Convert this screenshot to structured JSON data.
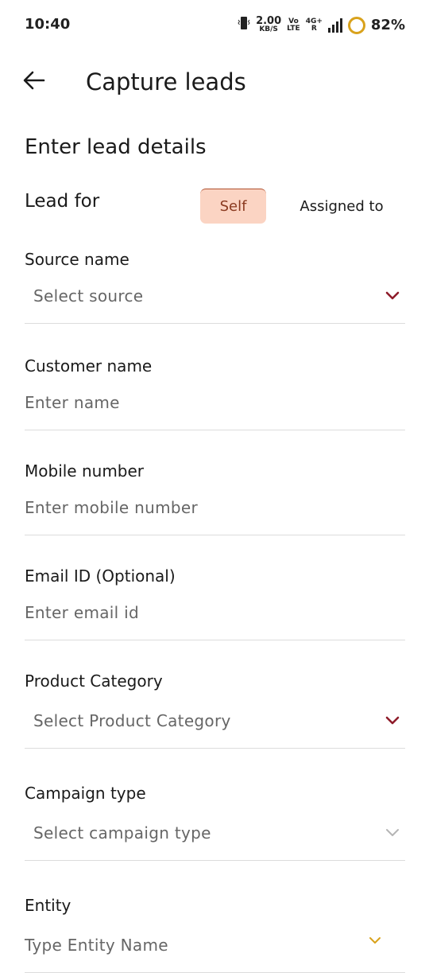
{
  "status_bar": {
    "time": "10:40",
    "net_speed_value": "2.00",
    "net_speed_unit": "KB/S",
    "volte_top": "Vo",
    "volte_bottom": "LTE",
    "network_top": "4G+",
    "network_bottom": "R",
    "battery": "82%",
    "battery_color": "#d9a21c"
  },
  "header": {
    "title": "Capture leads"
  },
  "form": {
    "section_title": "Enter lead details",
    "lead_for": {
      "label": "Lead for",
      "options": [
        "Self",
        "Assigned to"
      ],
      "selected": "Self"
    },
    "source": {
      "label": "Source name",
      "placeholder": "Select source"
    },
    "customer": {
      "label": "Customer name",
      "placeholder": "Enter name"
    },
    "mobile": {
      "label": "Mobile number",
      "placeholder": "Enter mobile number"
    },
    "email": {
      "label": "Email ID (Optional)",
      "placeholder": "Enter email id"
    },
    "product": {
      "label": "Product Category",
      "placeholder": "Select Product Category"
    },
    "campaign": {
      "label": "Campaign type",
      "placeholder": "Select campaign type"
    },
    "entity": {
      "label": "Entity",
      "placeholder": "Type Entity Name"
    }
  },
  "colors": {
    "accent_red": "#8e1c2a",
    "segment_selected_bg": "#fbd4c3",
    "chevron_disabled": "#b5b5b5",
    "chevron_entity": "#d9a21c"
  }
}
